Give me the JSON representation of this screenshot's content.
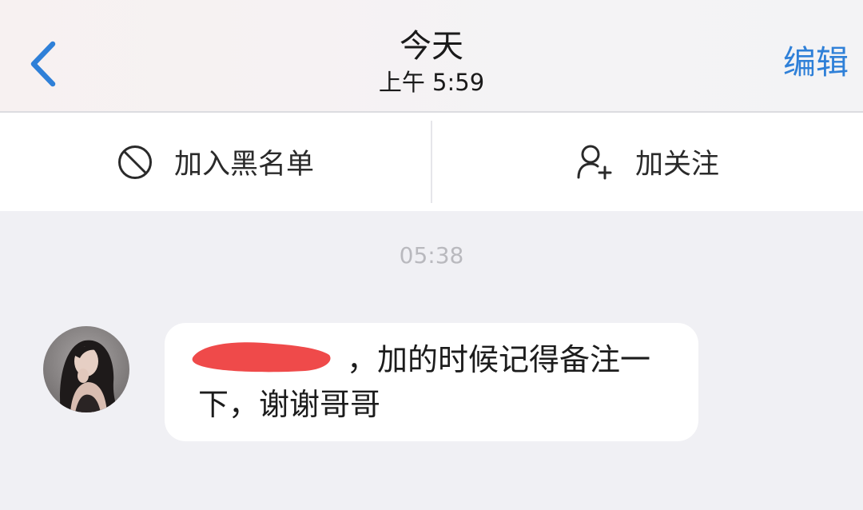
{
  "navbar": {
    "back_icon": "chevron-left-icon",
    "title": "今天",
    "subtitle": "上午 5:59",
    "edit_label": "编辑"
  },
  "actions": {
    "block_icon": "block-icon",
    "block_label": "加入黑名单",
    "follow_icon": "add-user-icon",
    "follow_label": "加关注"
  },
  "chat": {
    "timestamp": "05:38",
    "message": {
      "line1": "，加的时候记得备注一",
      "line2": "下，谢谢哥哥"
    }
  },
  "colors": {
    "accent": "#2f80d8",
    "redaction": "#ef4a4a"
  }
}
